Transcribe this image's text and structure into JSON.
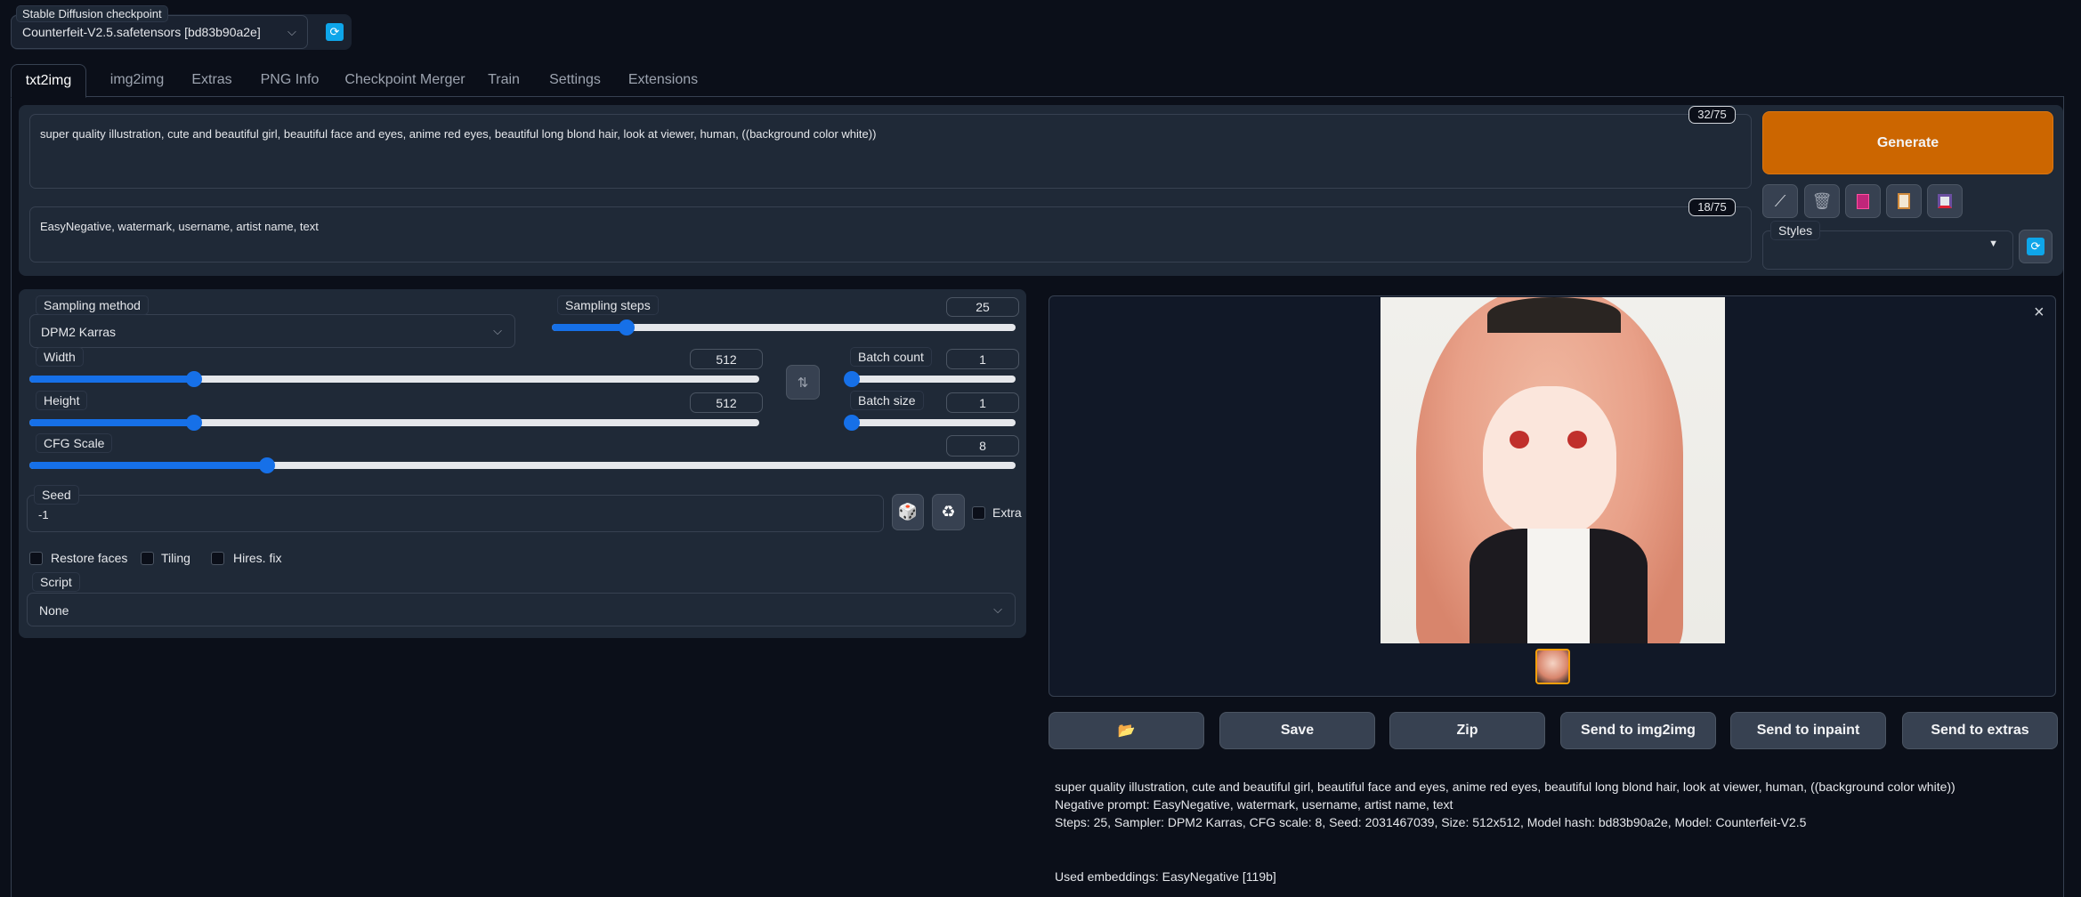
{
  "checkpoint": {
    "label": "Stable Diffusion checkpoint",
    "value": "Counterfeit-V2.5.safetensors [bd83b90a2e]",
    "refresh_icon": "refresh-icon"
  },
  "tabs": [
    {
      "label": "txt2img",
      "active": true
    },
    {
      "label": "img2img"
    },
    {
      "label": "Extras"
    },
    {
      "label": "PNG Info"
    },
    {
      "label": "Checkpoint Merger"
    },
    {
      "label": "Train"
    },
    {
      "label": "Settings"
    },
    {
      "label": "Extensions"
    }
  ],
  "prompt": {
    "value": "super quality illustration, cute and beautiful girl, beautiful face and eyes, anime red eyes, beautiful long blond hair, look at viewer, human, ((background color white))",
    "counter": "32/75"
  },
  "negative_prompt": {
    "value": "EasyNegative, watermark, username, artist name, text",
    "counter": "18/75"
  },
  "generate": {
    "label": "Generate",
    "color": "#cc6600"
  },
  "tools": [
    "pencil-icon",
    "trash-icon",
    "image-icon",
    "clipboard-icon",
    "floppy-disk-icon"
  ],
  "styles": {
    "label": "Styles",
    "value": ""
  },
  "params": {
    "sampling_method": {
      "label": "Sampling method",
      "value": "DPM2 Karras"
    },
    "sampling_steps": {
      "label": "Sampling steps",
      "value": "25",
      "min": 1,
      "max": 150
    },
    "width": {
      "label": "Width",
      "value": "512",
      "min": 64,
      "max": 2048
    },
    "height": {
      "label": "Height",
      "value": "512",
      "min": 64,
      "max": 2048
    },
    "batch_count": {
      "label": "Batch count",
      "value": "1",
      "min": 1,
      "max": 100
    },
    "batch_size": {
      "label": "Batch size",
      "value": "1",
      "min": 1,
      "max": 8
    },
    "cfg_scale": {
      "label": "CFG Scale",
      "value": "8",
      "min": 1,
      "max": 30
    },
    "seed": {
      "label": "Seed",
      "value": "-1"
    },
    "extra_label": "Extra",
    "restore_faces": "Restore faces",
    "tiling": "Tiling",
    "hires_fix": "Hires. fix",
    "script": {
      "label": "Script",
      "value": "None"
    }
  },
  "output": {
    "buttons": [
      "📂",
      "Save",
      "Zip",
      "Send to img2img",
      "Send to inpaint",
      "Send to extras"
    ],
    "info": [
      "super quality illustration, cute and beautiful girl, beautiful face and eyes, anime red eyes, beautiful long blond hair, look at viewer, human, ((background color white))",
      "Negative prompt: EasyNegative, watermark, username, artist name, text",
      "Steps: 25, Sampler: DPM2 Karras, CFG scale: 8, Seed: 2031467039, Size: 512x512, Model hash: bd83b90a2e, Model: Counterfeit-V2.5"
    ],
    "embeddings": "Used embeddings: EasyNegative [119b]",
    "close": "×"
  },
  "colors": {
    "background": "#0b0f19",
    "panel": "#1f2937",
    "accent": "#1670e8"
  }
}
